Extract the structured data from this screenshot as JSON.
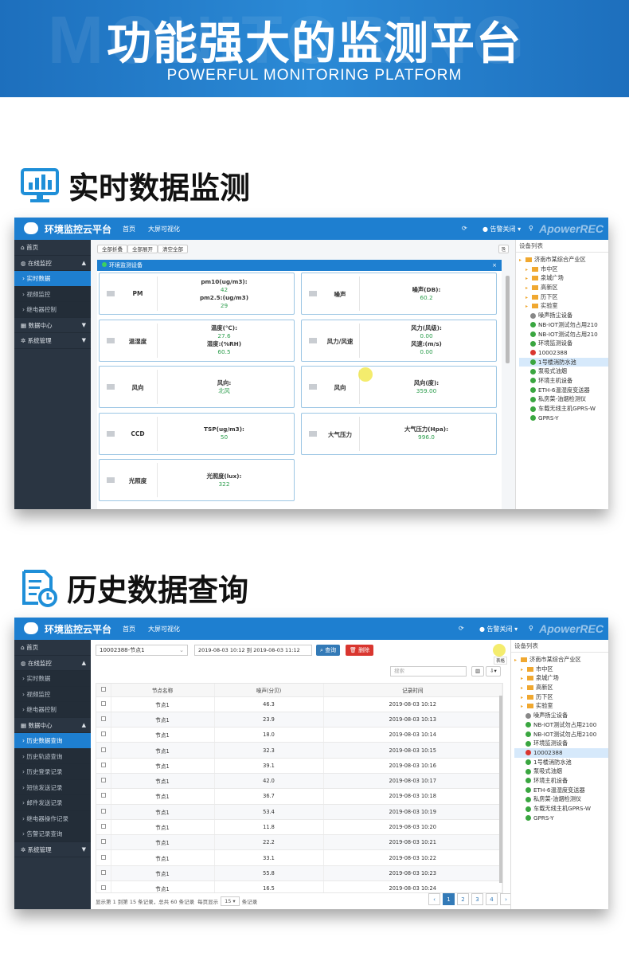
{
  "banner": {
    "watermark": "MONITORING",
    "title": "功能强大的监测平台",
    "subtitle": "POWERFUL MONITORING PLATFORM"
  },
  "section1": {
    "title": "实时数据监测",
    "icon": "monitor-chart-icon"
  },
  "section2": {
    "title": "历史数据查询",
    "icon": "document-clock-icon"
  },
  "app": {
    "brand": "环境监控云平台",
    "nav": [
      "首页",
      "大屏可视化"
    ],
    "alarm": "告警关闭",
    "watermark": "ApowerREC"
  },
  "sidebar1": [
    {
      "label": "首页",
      "icon": "home-icon",
      "type": "top"
    },
    {
      "label": "在线监控",
      "icon": "globe-icon",
      "type": "group",
      "caret": "▲"
    },
    {
      "label": "实时数据",
      "type": "sub",
      "active": true
    },
    {
      "label": "视频监控",
      "type": "sub"
    },
    {
      "label": "继电器控制",
      "type": "sub"
    },
    {
      "label": "数据中心",
      "icon": "grid-icon",
      "type": "group",
      "caret": "▼"
    },
    {
      "label": "系统管理",
      "icon": "gear-icon",
      "type": "group",
      "caret": "▼"
    }
  ],
  "sidebar2": [
    {
      "label": "首页",
      "icon": "home-icon",
      "type": "top"
    },
    {
      "label": "在线监控",
      "icon": "globe-icon",
      "type": "group",
      "caret": "▲"
    },
    {
      "label": "实时数据",
      "type": "sub"
    },
    {
      "label": "视频监控",
      "type": "sub"
    },
    {
      "label": "继电器控制",
      "type": "sub"
    },
    {
      "label": "数据中心",
      "icon": "grid-icon",
      "type": "group",
      "caret": "▲"
    },
    {
      "label": "历史数据查询",
      "type": "sub",
      "active": true
    },
    {
      "label": "历史轨迹查询",
      "type": "sub"
    },
    {
      "label": "历史登录记录",
      "type": "sub"
    },
    {
      "label": "短信发送记录",
      "type": "sub"
    },
    {
      "label": "邮件发送记录",
      "type": "sub"
    },
    {
      "label": "继电器操作记录",
      "type": "sub"
    },
    {
      "label": "告警记录查询",
      "type": "sub"
    },
    {
      "label": "系统管理",
      "icon": "gear-icon",
      "type": "group",
      "caret": "▼"
    }
  ],
  "realtime": {
    "toolbar": [
      "全部折叠",
      "全部展开",
      "清空全部"
    ],
    "panel_title": "环境监测设备",
    "cards": [
      {
        "name": "PM",
        "lines": [
          [
            "pm10(ug/m3):",
            "42"
          ],
          [
            "pm2.5:(ug/m3)",
            "29"
          ]
        ]
      },
      {
        "name": "噪声",
        "lines": [
          [
            "噪声(DB):",
            "60.2"
          ]
        ]
      },
      {
        "name": "温湿度",
        "lines": [
          [
            "温度(℃):",
            "27.6"
          ],
          [
            "湿度:(%RH)",
            "60.5"
          ]
        ]
      },
      {
        "name": "风力/风速",
        "lines": [
          [
            "风力(风级):",
            "0.00"
          ],
          [
            "风速:(m/s)",
            "0.00"
          ]
        ]
      },
      {
        "name": "风向",
        "lines": [
          [
            "风向:",
            "北风"
          ]
        ]
      },
      {
        "name": "风向",
        "lines": [
          [
            "风向(度):",
            "359.00"
          ]
        ]
      },
      {
        "name": "CCD",
        "lines": [
          [
            "TSP(ug/m3):",
            "50"
          ]
        ]
      },
      {
        "name": "大气压力",
        "lines": [
          [
            "大气压力(Hpa):",
            "996.0"
          ]
        ]
      },
      {
        "name": "光照度",
        "lines": [
          [
            "光照度(lux):",
            "322"
          ]
        ]
      }
    ]
  },
  "tree1": {
    "header": "设备列表",
    "nodes": [
      {
        "t": "济南市某综合产业区",
        "k": "root"
      },
      {
        "t": "市中区",
        "k": "folder"
      },
      {
        "t": "泉城广场",
        "k": "folder"
      },
      {
        "t": "高新区",
        "k": "folder"
      },
      {
        "t": "历下区",
        "k": "folder"
      },
      {
        "t": "实验室",
        "k": "folder"
      },
      {
        "t": "噪声扬尘设备",
        "k": "gray"
      },
      {
        "t": "NB-IOT测试勿占用210",
        "k": "green"
      },
      {
        "t": "NB-IOT测试勿占用210",
        "k": "green"
      },
      {
        "t": "环境监测设备",
        "k": "green"
      },
      {
        "t": "10002388",
        "k": "red"
      },
      {
        "t": "1号楼消防水池",
        "k": "green",
        "sel": true
      },
      {
        "t": "泵吸式油烟",
        "k": "green"
      },
      {
        "t": "环境主机设备",
        "k": "green"
      },
      {
        "t": "ETH-6温湿度变送器",
        "k": "green"
      },
      {
        "t": "私房菜-油烟检测仪",
        "k": "green"
      },
      {
        "t": "车载无线主机GPRS-W",
        "k": "green"
      },
      {
        "t": "GPRS-Y",
        "k": "green"
      }
    ]
  },
  "tree2": {
    "header": "设备列表",
    "nodes": [
      {
        "t": "济南市某综合产业区",
        "k": "root"
      },
      {
        "t": "市中区",
        "k": "folder"
      },
      {
        "t": "泉城广场",
        "k": "folder"
      },
      {
        "t": "高新区",
        "k": "folder"
      },
      {
        "t": "历下区",
        "k": "folder"
      },
      {
        "t": "实验室",
        "k": "folder"
      },
      {
        "t": "噪声扬尘设备",
        "k": "gray"
      },
      {
        "t": "NB-IOT测试勿占用2100",
        "k": "green"
      },
      {
        "t": "NB-IOT测试勿占用2100",
        "k": "green"
      },
      {
        "t": "环境监测设备",
        "k": "green"
      },
      {
        "t": "10002388",
        "k": "red",
        "sel": true
      },
      {
        "t": "1号楼消防水池",
        "k": "green"
      },
      {
        "t": "泵吸式油烟",
        "k": "green"
      },
      {
        "t": "环境主机设备",
        "k": "green"
      },
      {
        "t": "ETH-6温湿度变送器",
        "k": "green"
      },
      {
        "t": "私房菜-油烟检测仪",
        "k": "green"
      },
      {
        "t": "车载无线主机GPRS-W",
        "k": "green"
      },
      {
        "t": "GPRS-Y",
        "k": "green"
      }
    ]
  },
  "history": {
    "device_select": "10002388-节点1",
    "date_range": "2019-08-03 10:12 到 2019-08-03 11:12",
    "query_btn": "查询",
    "delete_btn": "删除",
    "search_placeholder": "搜索",
    "tooltip": "表格",
    "columns": [
      "节点名称",
      "噪声(分贝)",
      "记录时间"
    ],
    "rows": [
      [
        "节点1",
        "46.3",
        "2019-08-03 10:12"
      ],
      [
        "节点1",
        "23.9",
        "2019-08-03 10:13"
      ],
      [
        "节点1",
        "18.0",
        "2019-08-03 10:14"
      ],
      [
        "节点1",
        "32.3",
        "2019-08-03 10:15"
      ],
      [
        "节点1",
        "39.1",
        "2019-08-03 10:16"
      ],
      [
        "节点1",
        "42.0",
        "2019-08-03 10:17"
      ],
      [
        "节点1",
        "36.7",
        "2019-08-03 10:18"
      ],
      [
        "节点1",
        "53.4",
        "2019-08-03 10:19"
      ],
      [
        "节点1",
        "11.8",
        "2019-08-03 10:20"
      ],
      [
        "节点1",
        "22.2",
        "2019-08-03 10:21"
      ],
      [
        "节点1",
        "33.1",
        "2019-08-03 10:22"
      ],
      [
        "节点1",
        "55.8",
        "2019-08-03 10:23"
      ],
      [
        "节点1",
        "16.5",
        "2019-08-03 10:24"
      ],
      [
        "节点1",
        "21.5",
        "2019-08-03 10:25"
      ]
    ],
    "footer_info": "显示第 1 到第 15 条记录，总共 60 条记录",
    "per_page_prefix": "每页显示",
    "per_page": "15",
    "per_page_suffix": "条记录",
    "pages": [
      "‹",
      "1",
      "2",
      "3",
      "4",
      "›"
    ],
    "current_page": "1"
  }
}
